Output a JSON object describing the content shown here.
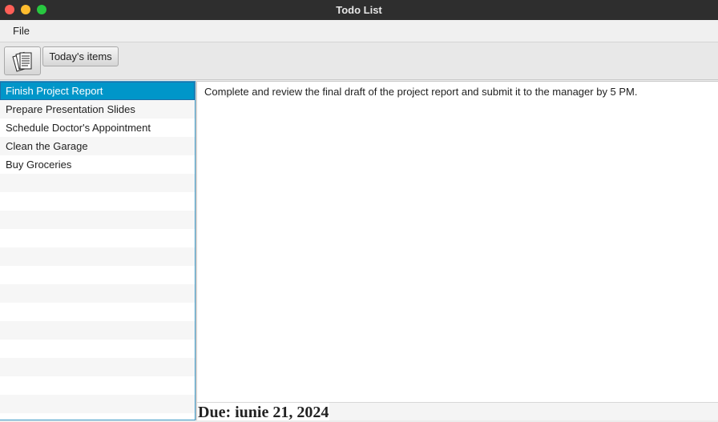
{
  "window": {
    "title": "Todo List"
  },
  "menubar": {
    "items": [
      {
        "label": "File"
      }
    ]
  },
  "toolbar": {
    "icon_button": {
      "icon": "documents-icon"
    },
    "today_button_label": "Today's items"
  },
  "todo_list": {
    "items": [
      {
        "label": "Finish Project Report",
        "selected": true
      },
      {
        "label": "Prepare Presentation Slides",
        "selected": false
      },
      {
        "label": "Schedule Doctor's Appointment",
        "selected": false
      },
      {
        "label": "Clean the Garage",
        "selected": false
      },
      {
        "label": "Buy Groceries",
        "selected": false
      }
    ]
  },
  "detail": {
    "description": "Complete and review the final draft of the project report and submit it to the manager by 5 PM.",
    "due": "Due: iunie 21, 2024"
  },
  "colors": {
    "selection": "#0096c9",
    "list_border": "#3d9ac8",
    "titlebar": "#2e2e2e"
  }
}
